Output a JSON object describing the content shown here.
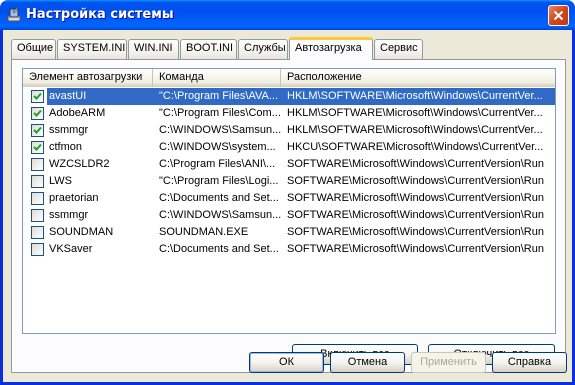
{
  "window": {
    "title": "Настройка системы",
    "icon": "system-config-icon",
    "close_icon": "close-icon"
  },
  "tabs": [
    {
      "label": "Общие"
    },
    {
      "label": "SYSTEM.INI"
    },
    {
      "label": "WIN.INI"
    },
    {
      "label": "BOOT.INI"
    },
    {
      "label": "Службы"
    },
    {
      "label": "Автозагрузка",
      "active": true
    },
    {
      "label": "Сервис"
    }
  ],
  "startup_list": {
    "columns": [
      "Элемент автозагрузки",
      "Команда",
      "Расположение"
    ],
    "rows": [
      {
        "checked": true,
        "selected": true,
        "item": "avastUI",
        "command": "\"C:\\Program Files\\AVA...",
        "location": "HKLM\\SOFTWARE\\Microsoft\\Windows\\CurrentVer..."
      },
      {
        "checked": true,
        "selected": false,
        "item": "AdobeARM",
        "command": "\"C:\\Program Files\\Com...",
        "location": "HKLM\\SOFTWARE\\Microsoft\\Windows\\CurrentVer..."
      },
      {
        "checked": true,
        "selected": false,
        "item": "ssmmgr",
        "command": "C:\\WINDOWS\\Samsun...",
        "location": "HKLM\\SOFTWARE\\Microsoft\\Windows\\CurrentVer..."
      },
      {
        "checked": true,
        "selected": false,
        "item": "ctfmon",
        "command": "C:\\WINDOWS\\system...",
        "location": "HKCU\\SOFTWARE\\Microsoft\\Windows\\CurrentVer..."
      },
      {
        "checked": false,
        "selected": false,
        "item": "WZCSLDR2",
        "command": "C:\\Program Files\\ANI\\...",
        "location": "SOFTWARE\\Microsoft\\Windows\\CurrentVersion\\Run"
      },
      {
        "checked": false,
        "selected": false,
        "item": "LWS",
        "command": "\"C:\\Program Files\\Logi...",
        "location": "SOFTWARE\\Microsoft\\Windows\\CurrentVersion\\Run"
      },
      {
        "checked": false,
        "selected": false,
        "item": "praetorian",
        "command": "C:\\Documents and Set...",
        "location": "SOFTWARE\\Microsoft\\Windows\\CurrentVersion\\Run"
      },
      {
        "checked": false,
        "selected": false,
        "item": "ssmmgr",
        "command": "C:\\WINDOWS\\Samsun...",
        "location": "SOFTWARE\\Microsoft\\Windows\\CurrentVersion\\Run"
      },
      {
        "checked": false,
        "selected": false,
        "item": "SOUNDMAN",
        "command": "SOUNDMAN.EXE",
        "location": "SOFTWARE\\Microsoft\\Windows\\CurrentVersion\\Run"
      },
      {
        "checked": false,
        "selected": false,
        "item": "VKSaver",
        "command": "C:\\Documents and Set...",
        "location": "SOFTWARE\\Microsoft\\Windows\\CurrentVersion\\Run"
      }
    ]
  },
  "panel_buttons": {
    "enable_all": "Включить все",
    "disable_all": "Отключить все"
  },
  "dialog_buttons": {
    "ok": "ОК",
    "cancel": "Отмена",
    "apply": "Применить",
    "apply_enabled": false,
    "help": "Справка"
  },
  "colors": {
    "titlebar": "#0054e3",
    "selection": "#316ac5",
    "checkmark": "#21a121",
    "dialog_bg": "#ece9d8"
  }
}
